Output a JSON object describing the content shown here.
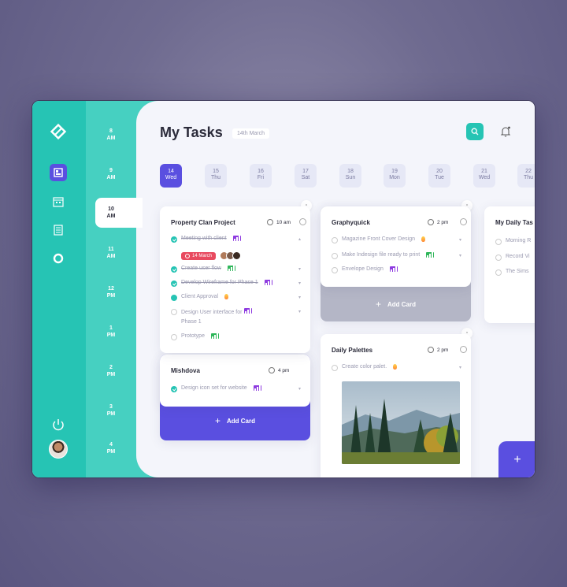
{
  "rail": {
    "items": [
      "logo-icon",
      "board-icon",
      "calendar-icon",
      "list-icon",
      "circle-icon"
    ],
    "active": "board-icon",
    "power_icon": "power-icon"
  },
  "times": [
    {
      "h": "8",
      "p": "AM"
    },
    {
      "h": "9",
      "p": "AM"
    },
    {
      "h": "10",
      "p": "AM"
    },
    {
      "h": "11",
      "p": "AM"
    },
    {
      "h": "12",
      "p": "PM"
    },
    {
      "h": "1",
      "p": "PM"
    },
    {
      "h": "2",
      "p": "PM"
    },
    {
      "h": "3",
      "p": "PM"
    },
    {
      "h": "4",
      "p": "PM"
    }
  ],
  "header": {
    "title": "My Tasks",
    "date": "14th March"
  },
  "days": [
    {
      "d": "14",
      "w": "Wed"
    },
    {
      "d": "15",
      "w": "Thu"
    },
    {
      "d": "16",
      "w": "Fri"
    },
    {
      "d": "17",
      "w": "Sat"
    },
    {
      "d": "18",
      "w": "Sun"
    },
    {
      "d": "19",
      "w": "Mon"
    },
    {
      "d": "20",
      "w": "Tue"
    },
    {
      "d": "21",
      "w": "Wed"
    },
    {
      "d": "22",
      "w": "Thu"
    }
  ],
  "cards": {
    "property": {
      "title": "Property Clan Project",
      "time": "10 am",
      "due": "14 March",
      "tasks": [
        "Meeting with client",
        "Create user flow",
        "Develop Wireframe for Phase 1",
        "Client Approval",
        "Design User interface for",
        "Phase 1",
        "Prototype"
      ]
    },
    "mishdova": {
      "title": "Mishdova",
      "time": "4 pm",
      "tasks": [
        "Design icon set for website"
      ],
      "add": "Add Card"
    },
    "graphyquick": {
      "title": "Graphyquick",
      "time": "2 pm",
      "tasks": [
        "Magazine Front Cover Design",
        "Make Indesign file ready to print",
        "Envelope Design"
      ],
      "add": "Add Card"
    },
    "palettes": {
      "title": "Daily Palettes",
      "time": "2 pm",
      "tasks": [
        "Create color palet."
      ]
    },
    "daily": {
      "title": "My Daily Tas",
      "tasks": [
        "Morning R",
        "Record Vi",
        "The Sims"
      ]
    }
  },
  "fab": "+",
  "colors": {
    "teal": "#26c4b4",
    "purple": "#5a4fe0",
    "gray": "#b4b6c6"
  }
}
